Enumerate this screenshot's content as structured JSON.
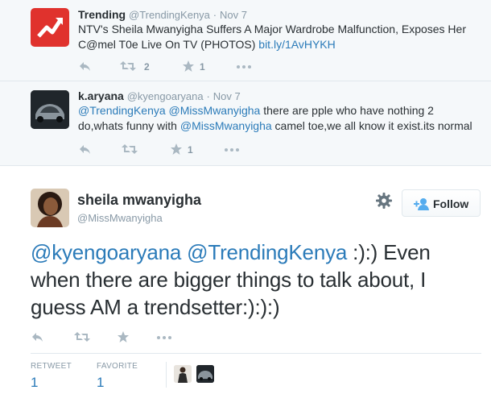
{
  "tweets": [
    {
      "name": "Trending",
      "handle": "@TrendingKenya",
      "time": "Nov 7",
      "text": "NTV's Sheila Mwanyigha Suffers A Major Wardrobe Malfunction, Exposes Her",
      "text2": "C@mel T0e Live On TV (PHOTOS) ",
      "link": "bit.ly/1AvHYKH",
      "retweets": "2",
      "favorites": "1"
    },
    {
      "name": "k.aryana",
      "handle": "@kyengoaryana",
      "time": "Nov 7",
      "mention1": "@TrendingKenya",
      "mention2": "@MissMwanyigha",
      "text_a": " there are pple who have nothing 2",
      "text_b": "do,whats funny with ",
      "mention3": "@MissMwanyigha",
      "text_c": " camel toe,we all know it exist.its normal",
      "favorites": "1"
    }
  ],
  "main": {
    "name": "sheila mwanyigha",
    "handle": "@MissMwanyigha",
    "follow_label": "Follow",
    "mention1": "@kyengoaryana",
    "mention2": "@TrendingKenya",
    "text1": " :):) Even",
    "text2": "when there are bigger things to talk about, I",
    "text3": "guess AM a trendsetter:):):)",
    "retweet_label": "RETWEET",
    "retweet_count": "1",
    "favorite_label": "FAVORITE",
    "favorite_count": "1"
  },
  "icons": {
    "reply": "reply-icon",
    "retweet": "retweet-icon",
    "favorite": "star-icon",
    "more": "more-icon",
    "gear": "gear-icon",
    "follow": "add-user-icon"
  },
  "colors": {
    "link": "#2b7bb9",
    "trending_logo": "#e0322d",
    "background_context": "#f5f8fa"
  }
}
